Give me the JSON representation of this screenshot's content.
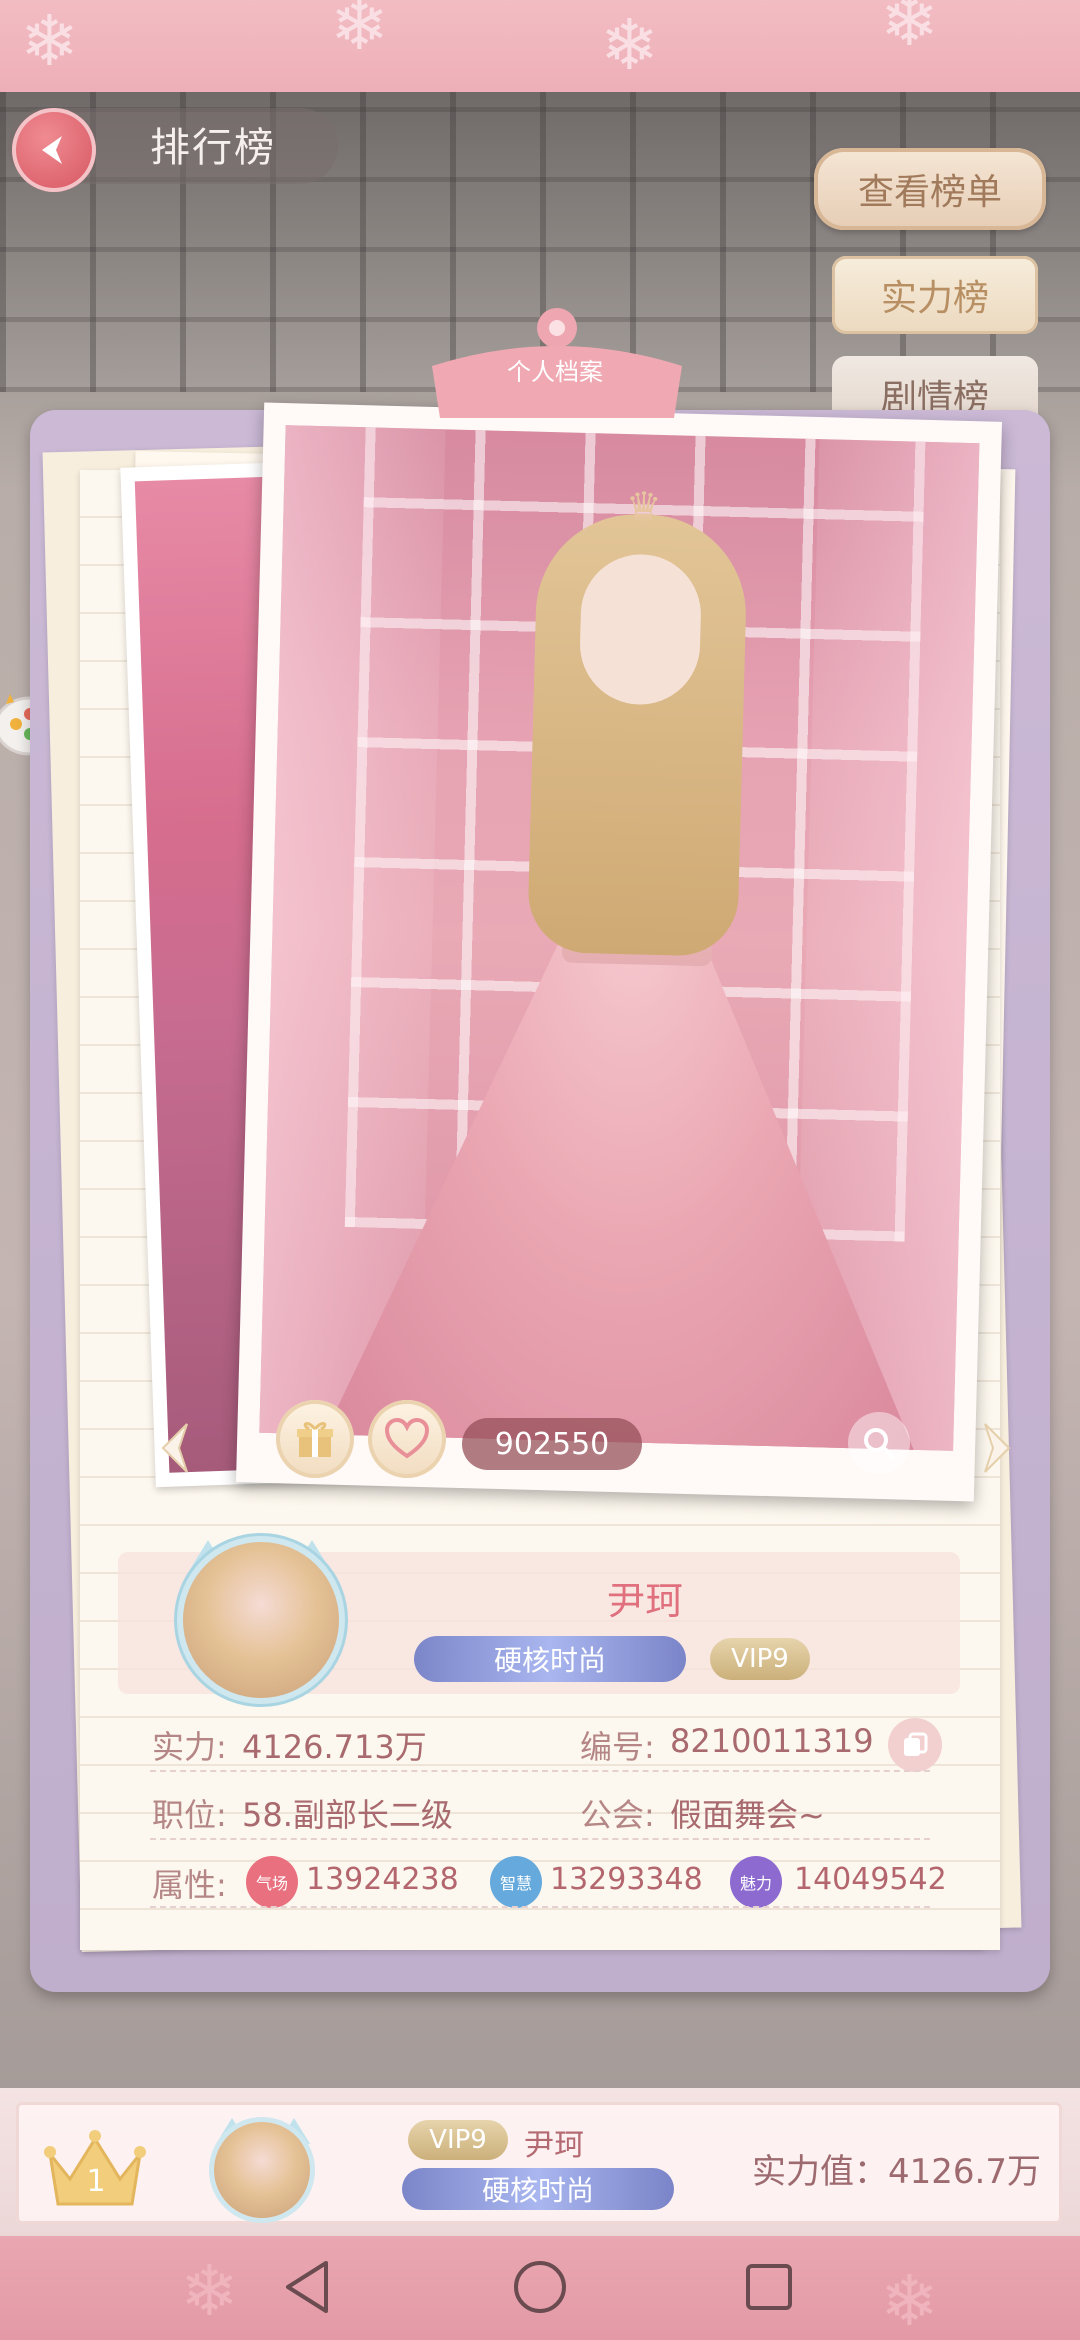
{
  "header": {
    "back_label": "排行榜"
  },
  "right_menu": {
    "view_list": "查看榜单",
    "strength_list": "实力榜",
    "story_list": "剧情榜"
  },
  "photo": {
    "clip_label": "个人档案",
    "like_count": "902550"
  },
  "profile": {
    "name": "尹珂",
    "title_badge": "硬核时尚",
    "vip": "VIP9",
    "strength_label": "实力:",
    "strength_value": "4126.713万",
    "id_label": "编号:",
    "id_value": "8210011319",
    "position_label": "职位:",
    "position_value": "58.副部长二级",
    "guild_label": "公会:",
    "guild_value": "假面舞会~",
    "attr_label": "属性:",
    "attributes": [
      {
        "icon_text": "气场",
        "value": "13924238",
        "color": "#e9707f"
      },
      {
        "icon_text": "智慧",
        "value": "13293348",
        "color": "#66a9dc"
      },
      {
        "icon_text": "魅力",
        "value": "14049542",
        "color": "#8c6ad0"
      }
    ]
  },
  "bottom": {
    "rank": "1",
    "vip": "VIP9",
    "name": "尹珂",
    "title_badge": "硬核时尚",
    "strength": "实力值：4126.7万"
  },
  "colors": {
    "accent_pink": "#e0707d",
    "title_badge": "#7b86c9",
    "vip_gold": "#cbb07a"
  }
}
